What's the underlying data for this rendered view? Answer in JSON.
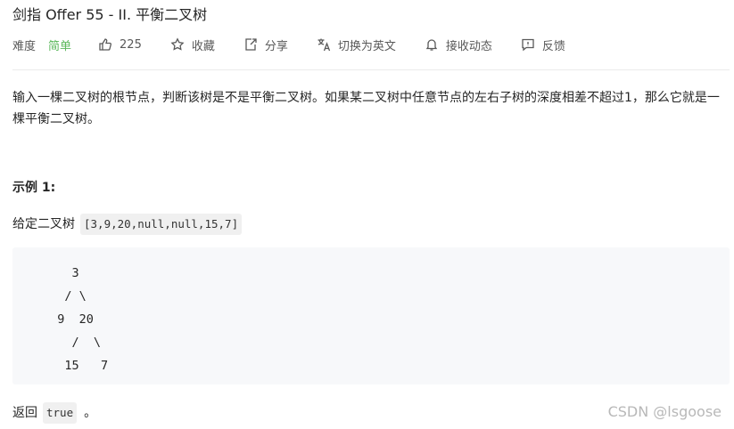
{
  "problem": {
    "title": "剑指 Offer 55 - II. 平衡二叉树"
  },
  "meta": {
    "difficulty_label": "难度",
    "difficulty_value": "简单",
    "likes": "225",
    "favorite_label": "收藏",
    "share_label": "分享",
    "translate_label": "切换为英文",
    "notify_label": "接收动态",
    "feedback_label": "反馈",
    "difficulty_color": "#5cb85c"
  },
  "description": {
    "text": "输入一棵二叉树的根节点，判断该树是不是平衡二叉树。如果某二叉树中任意节点的左右子树的深度相差不超过1，那么它就是一棵平衡二叉树。"
  },
  "example": {
    "title": "示例 1:",
    "given_label": "给定二叉树",
    "given_value": "[3,9,20,null,null,15,7]",
    "tree_ascii": "    3\n   / \\\n  9  20\n    /  \\\n   15   7",
    "return_label": "返回",
    "return_value": "true",
    "return_suffix": "。"
  },
  "watermark": "CSDN @lsgoose",
  "icons": [
    "thumbs-up-icon",
    "star-icon",
    "share-icon",
    "translate-icon",
    "bell-icon",
    "feedback-icon"
  ]
}
